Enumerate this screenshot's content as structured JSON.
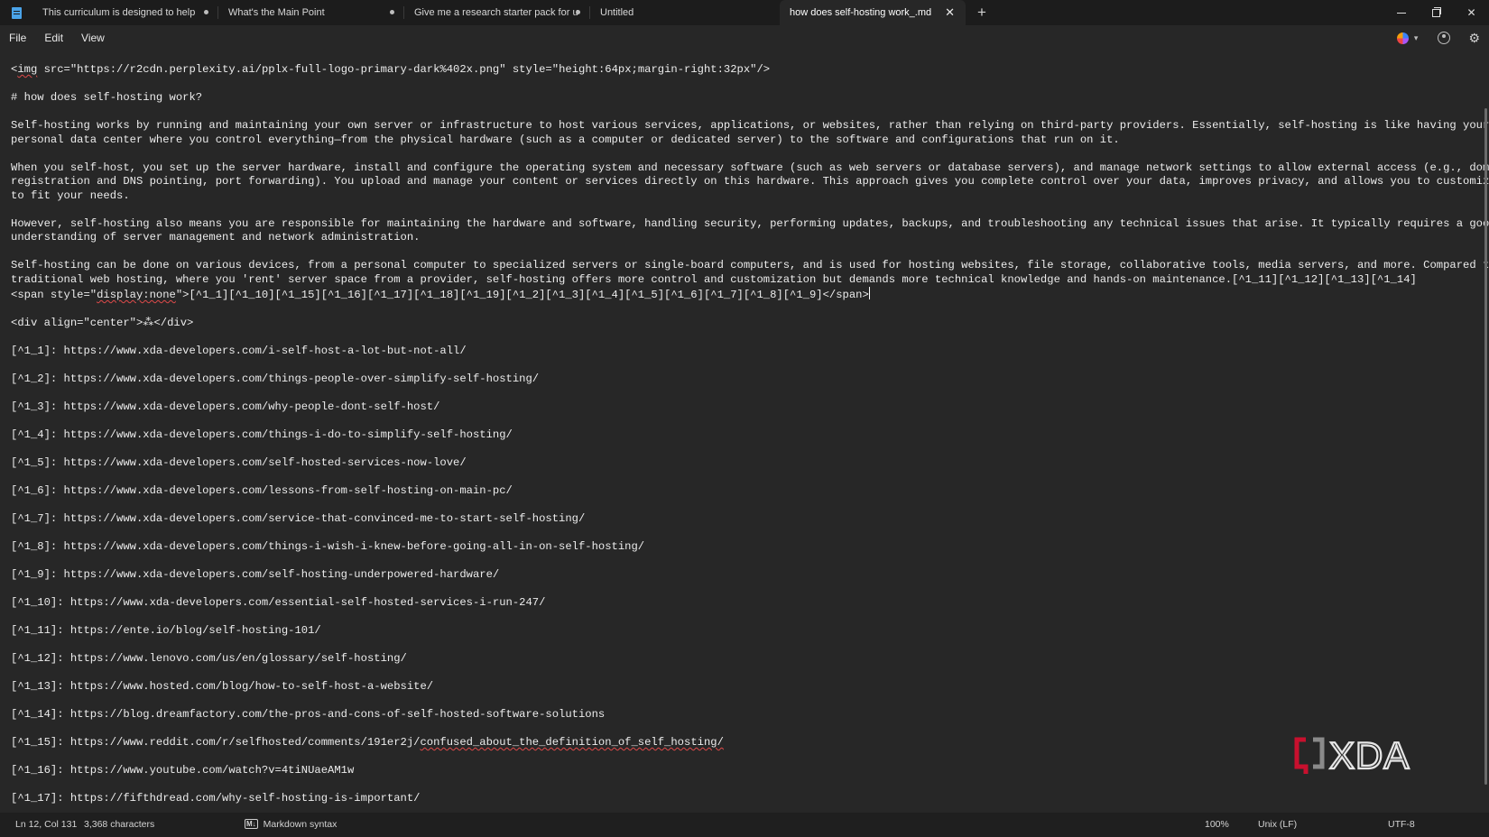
{
  "tabs": [
    {
      "label": "This curriculum is designed to help",
      "unsaved": true
    },
    {
      "label": "What's the Main Point",
      "unsaved": true
    },
    {
      "label": "Give me a research starter pack for u",
      "unsaved": true
    },
    {
      "label": "Untitled",
      "unsaved": false
    },
    {
      "label": "how does self-hosting work_.md",
      "active": true
    }
  ],
  "menu": {
    "file": "File",
    "edit": "Edit",
    "view": "View"
  },
  "icons": {
    "app": "notepad-icon",
    "new_tab": "plus-icon",
    "close": "close-icon",
    "copilot": "copilot-icon",
    "account": "account-icon",
    "settings": "gear-icon"
  },
  "editor": {
    "img_prefix": "<",
    "img_tag": "img",
    "img_rest": " src=\"https://r2cdn.perplexity.ai/pplx-full-logo-primary-dark%402x.png\" style=\"height:64px;margin-right:32px\"/>",
    "heading": "# how does self-hosting work?",
    "p1_l1": "Self-hosting works by running and maintaining your own server or infrastructure to host various services, applications, or websites, rather than relying on third-party providers. Essentially, self-hosting is like having your own",
    "p1_l2": "personal data center where you control everything—from the physical hardware (such as a computer or dedicated server) to the software and configurations that run on it.",
    "p2_l1": "When you self-host, you set up the server hardware, install and configure the operating system and necessary software (such as web servers or database servers), and manage network settings to allow external access (e.g., domain name",
    "p2_l2": "registration and DNS pointing, port forwarding). You upload and manage your content or services directly on this hardware. This approach gives you complete control over your data, improves privacy, and allows you to customize services",
    "p2_l3": "to fit your needs.",
    "p3_l1": "However, self-hosting also means you are responsible for maintaining the hardware and software, handling security, performing updates, backups, and troubleshooting any technical issues that arise. It typically requires a good",
    "p3_l2": "understanding of server management and network administration.",
    "p4_l1": "Self-hosting can be done on various devices, from a personal computer to specialized servers or single-board computers, and is used for hosting websites, file storage, collaborative tools, media servers, and more. Compared to",
    "p4_l2": "traditional web hosting, where you 'rent' server space from a provider, self-hosting offers more control and customization but demands more technical knowledge and hands-on maintenance.[^1_11][^1_12][^1_13][^1_14]",
    "span_a": "<span style=\"",
    "span_b": "display:none",
    "span_c": "\">[^1_1][^1_10][^1_15][^1_16][^1_17][^1_18][^1_19][^1_2][^1_3][^1_4][^1_5][^1_6][^1_7][^1_8][^1_9]</span>",
    "div_line": "<div align=\"center\">⁂</div>",
    "refs": [
      "[^1_1]: https://www.xda-developers.com/i-self-host-a-lot-but-not-all/",
      "[^1_2]: https://www.xda-developers.com/things-people-over-simplify-self-hosting/",
      "[^1_3]: https://www.xda-developers.com/why-people-dont-self-host/",
      "[^1_4]: https://www.xda-developers.com/things-i-do-to-simplify-self-hosting/",
      "[^1_5]: https://www.xda-developers.com/self-hosted-services-now-love/",
      "[^1_6]: https://www.xda-developers.com/lessons-from-self-hosting-on-main-pc/",
      "[^1_7]: https://www.xda-developers.com/service-that-convinced-me-to-start-self-hosting/",
      "[^1_8]: https://www.xda-developers.com/things-i-wish-i-knew-before-going-all-in-on-self-hosting/",
      "[^1_9]: https://www.xda-developers.com/self-hosting-underpowered-hardware/",
      "[^1_10]: https://www.xda-developers.com/essential-self-hosted-services-i-run-247/",
      "[^1_11]: https://ente.io/blog/self-hosting-101/",
      "[^1_12]: https://www.lenovo.com/us/en/glossary/self-hosting/",
      "[^1_13]: https://www.hosted.com/blog/how-to-self-host-a-website/",
      "[^1_14]: https://blog.dreamfactory.com/the-pros-and-cons-of-self-hosted-software-solutions"
    ],
    "ref15_a": "[^1_15]: https://www.reddit.com/r/selfhosted/comments/191er2j/",
    "ref15_b": "confused_about_the_definition_of_self_hosting/",
    "ref16": "[^1_16]: https://www.youtube.com/watch?v=4tiNUaeAM1w",
    "ref17": "[^1_17]: https://fifthdread.com/why-self-hosting-is-important/"
  },
  "watermark": {
    "text": "XDA",
    "color": "#e6e6e6",
    "accent": "#c8102e"
  },
  "status": {
    "position": "Ln 12, Col 131",
    "chars": "3,368 characters",
    "syntax_badge": "M↓",
    "syntax": "Markdown syntax",
    "zoom": "100%",
    "line_ending": "Unix (LF)",
    "encoding": "UTF-8"
  }
}
